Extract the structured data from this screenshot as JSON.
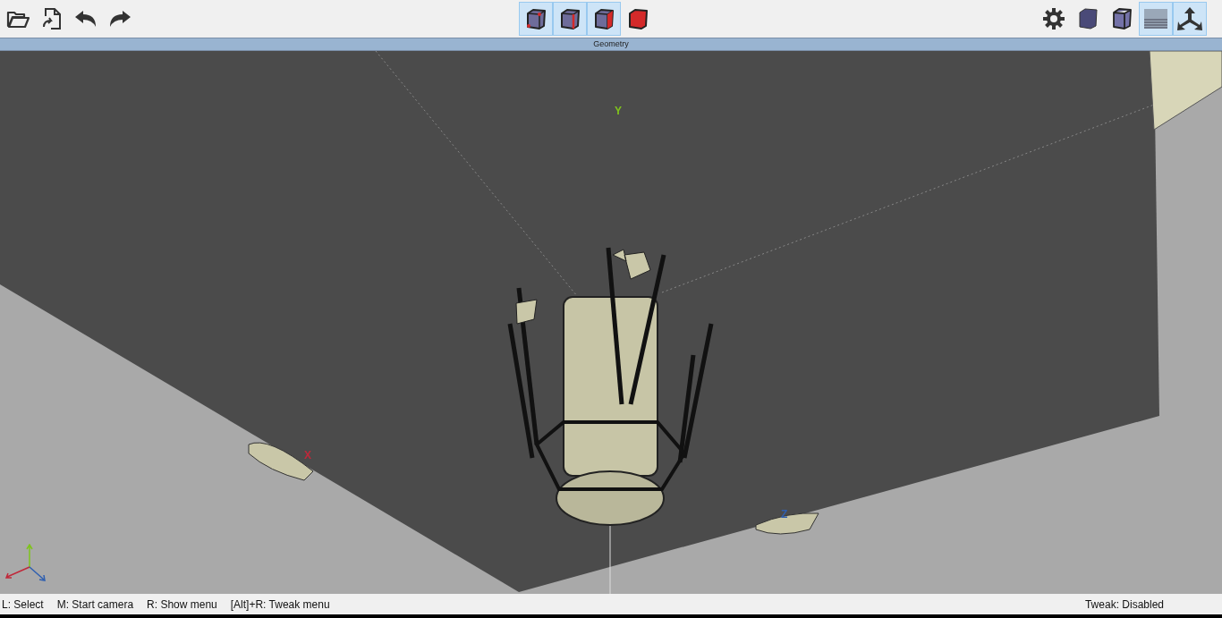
{
  "toolbar": {
    "left_buttons": [
      {
        "kind": "open",
        "selected": false
      },
      {
        "kind": "reload",
        "selected": false
      },
      {
        "kind": "undo",
        "selected": false
      },
      {
        "kind": "redo",
        "selected": false
      }
    ],
    "center_buttons": [
      {
        "kind": "cube-vertex",
        "selected": true
      },
      {
        "kind": "cube-edge",
        "selected": true
      },
      {
        "kind": "cube-face",
        "selected": true
      },
      {
        "kind": "cube-solid",
        "selected": false
      }
    ],
    "right_buttons": [
      {
        "kind": "settings",
        "selected": false
      },
      {
        "kind": "cube-shaded",
        "selected": false
      },
      {
        "kind": "cube-outlined",
        "selected": false
      },
      {
        "kind": "grid-floor",
        "selected": true
      },
      {
        "kind": "axes",
        "selected": true
      }
    ]
  },
  "panel": {
    "title": "Geometry"
  },
  "viewport": {
    "axis_labels": [
      {
        "text": "Y",
        "color": "#7fc31c"
      },
      {
        "text": "X",
        "color": "#c0283a"
      },
      {
        "text": "Z",
        "color": "#2f5fb0"
      }
    ]
  },
  "status_bar": {
    "hints": [
      "L: Select",
      "M: Start camera",
      "R: Show menu",
      "[Alt]+R: Tweak menu"
    ],
    "tweak": "Tweak: Disabled"
  }
}
